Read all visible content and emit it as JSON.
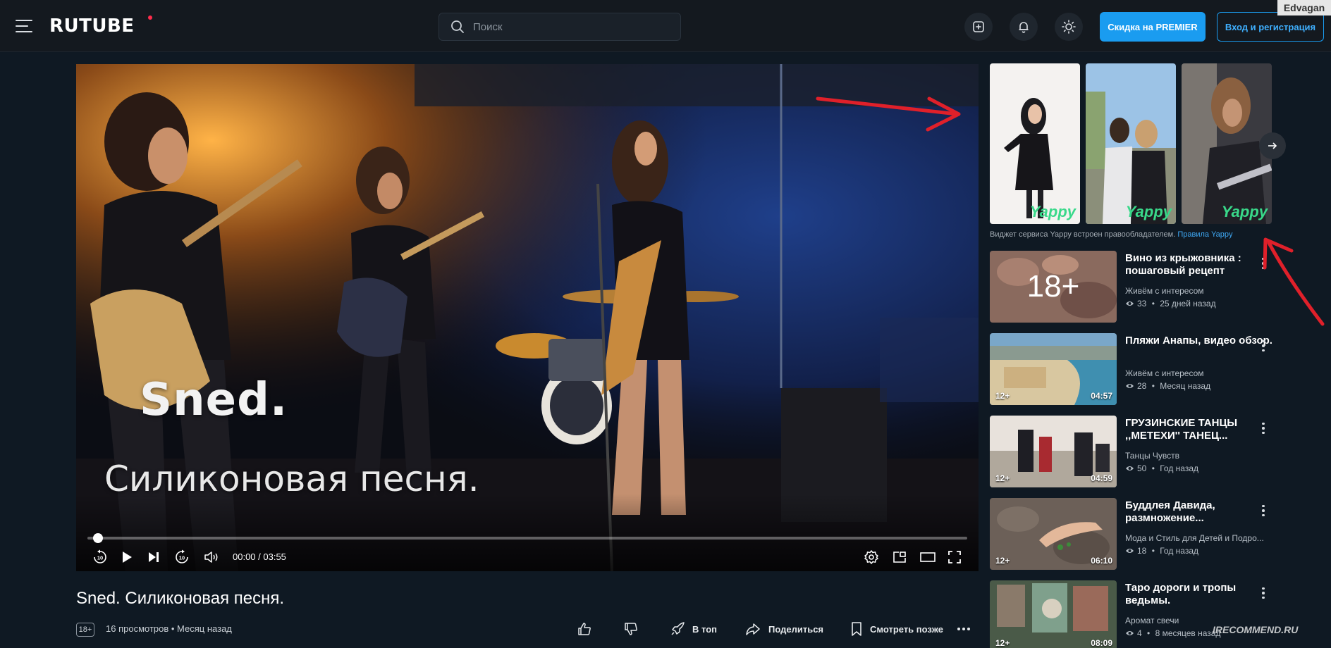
{
  "header": {
    "logo": "RUTUBE",
    "search_placeholder": "Поиск",
    "premier_button": "Скидка на PREMIER",
    "login_button": "Вход и регистрация",
    "user_tag": "Edvagan",
    "icons": [
      "menu-icon",
      "search-icon",
      "upload-icon",
      "bell-icon",
      "theme-sun-icon"
    ]
  },
  "player": {
    "overlay_title": "Sned.",
    "overlay_subtitle": "Силиконовая песня.",
    "current_time": "00:00 / 03:55",
    "progress_fraction": 0.0,
    "controls": [
      "rewind-10-icon",
      "play-icon",
      "next-icon",
      "forward-10-icon",
      "volume-icon",
      "settings-icon",
      "miniplayer-icon",
      "theater-icon",
      "fullscreen-icon"
    ]
  },
  "video": {
    "title": "Sned. Силиконовая песня.",
    "age": "18+",
    "meta": "16 просмотров  •  Месяц назад",
    "actions": {
      "top": "В топ",
      "share": "Поделиться",
      "later": "Смотреть позже"
    }
  },
  "yappy": {
    "logo": "Yappy",
    "note": "Виджет сервиса Yappy встроен правообладателем.",
    "rules_link": "Правила Yappy"
  },
  "recommendations": [
    {
      "title": "Вино из крыжовника : пошаговый рецепт",
      "channel": "Живём с интересом",
      "views": "33",
      "date": "25 дней назад",
      "age": "",
      "duration": "",
      "thumb_label": "18+"
    },
    {
      "title": "Пляжи Анапы, видео обзор.",
      "channel": "Живём с интересом",
      "views": "28",
      "date": "Месяц назад",
      "age": "12+",
      "duration": "04:57",
      "thumb_label": ""
    },
    {
      "title": "ГРУЗИНСКИЕ ТАНЦЫ ,,МЕТЕХИ'' ТАНЕЦ...",
      "channel": "Танцы Чувств",
      "views": "50",
      "date": "Год назад",
      "age": "12+",
      "duration": "04:59",
      "thumb_label": ""
    },
    {
      "title": "Буддлея Давида, размножение...",
      "channel": "Мода и Стиль для Детей и Подро...",
      "views": "18",
      "date": "Год назад",
      "age": "12+",
      "duration": "06:10",
      "thumb_label": ""
    },
    {
      "title": "Таро дороги и тропы ведьмы.",
      "channel": "Аромат свечи",
      "views": "4",
      "date": "8 месяцев назад",
      "age": "12+",
      "duration": "08:09",
      "thumb_label": ""
    }
  ],
  "watermark": "IRECOMMEND.RU",
  "colors": {
    "accent": "#1a9cf0",
    "background": "#0f1923",
    "annotation": "#e0202a",
    "yappy": "#39d98a"
  }
}
